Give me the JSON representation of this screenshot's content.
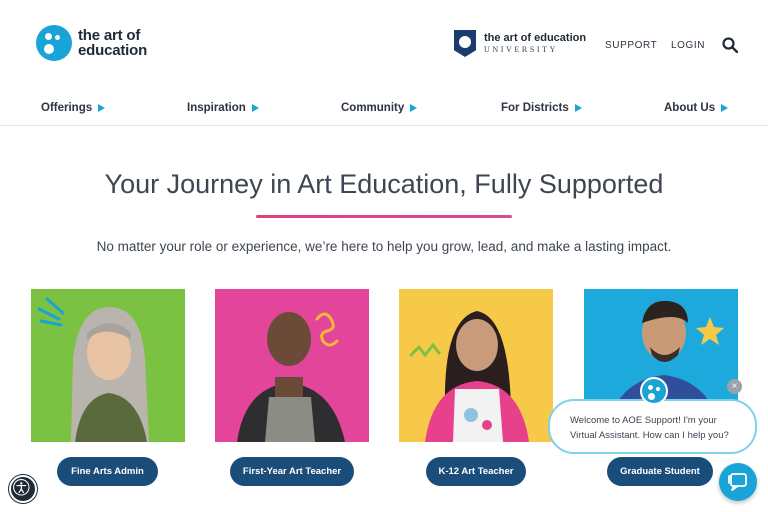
{
  "brand": {
    "line1": "the art of",
    "line2": "education",
    "color": "#1aa3d6"
  },
  "university": {
    "title": "the art of education",
    "subtitle": "UNIVERSITY"
  },
  "header_links": {
    "support": "SUPPORT",
    "login": "LOGIN",
    "search_icon": "search-icon"
  },
  "nav": {
    "items": [
      {
        "label": "Offerings"
      },
      {
        "label": "Inspiration"
      },
      {
        "label": "Community"
      },
      {
        "label": "For Districts"
      },
      {
        "label": "About Us"
      }
    ],
    "arrow_color": "#1aa3d6"
  },
  "hero": {
    "title": "Your Journey in Art Education, Fully Supported",
    "subtitle": "No matter your role or experience, we’re here to help you grow, lead, and make a lasting impact.",
    "accent": "#e0407f"
  },
  "cards": [
    {
      "label": "Fine Arts Admin",
      "bg": "#7cc242"
    },
    {
      "label": "First-Year Art Teacher",
      "bg": "#e2459a"
    },
    {
      "label": "K-12 Art Teacher",
      "bg": "#f7c948"
    },
    {
      "label": "Graduate Student",
      "bg": "#1ea9dc"
    }
  ],
  "chat": {
    "line1": "Welcome to AOE Support! I'm your",
    "line2": "Virtual Assistant. How can I help you?",
    "close": "×"
  },
  "button_color": "#1b4d7a"
}
